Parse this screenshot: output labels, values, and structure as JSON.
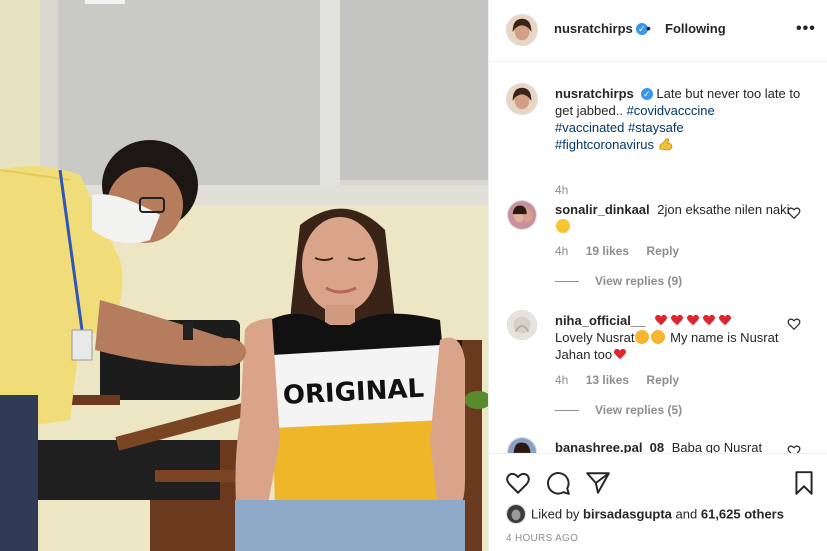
{
  "post": {
    "username": "nusratchirps",
    "verified_mark": "✓",
    "separator": "•",
    "follow_status": "Following",
    "more_label": "•••"
  },
  "caption": {
    "username": "nusratchirps",
    "text": "Late but never too late to get jabbed..",
    "hashtags": [
      "#covidvacccine",
      "#vaccinated",
      "#staysafe",
      "#fightcoronavirus"
    ],
    "time": "4h"
  },
  "comments": [
    {
      "username": "sonalir_dinkaal",
      "text": "2jon eksathe nilen naki",
      "emoji": "joy-emoji",
      "time": "4h",
      "likes": "19 likes",
      "reply_label": "Reply",
      "view_replies": "View replies (9)"
    },
    {
      "username": "niha_official__",
      "text_part1": "Lovely Nusrat",
      "text_part2": "My name is Nusrat Jahan too",
      "emojis": [
        "red-heart-emoji",
        "red-heart-emoji",
        "red-heart-emoji",
        "red-heart-emoji",
        "red-heart-emoji"
      ],
      "time": "4h",
      "likes": "13 likes",
      "reply_label": "Reply",
      "view_replies": "View replies (5)"
    },
    {
      "username": "banashree.pal_08",
      "text": "Baba go Nusrat"
    }
  ],
  "actions": {
    "icons": [
      "heart-icon",
      "comment-icon",
      "share-icon",
      "bookmark-icon"
    ]
  },
  "likes": {
    "prefix": "Liked by",
    "liker": "birsadasgupta",
    "connector": "and",
    "others": "61,625 others"
  },
  "timestamp": "4 HOURS AGO",
  "photo": {
    "shirt_text": "ORIGINAL"
  },
  "colors": {
    "link": "#00376b",
    "verified": "#3897f0",
    "secondary": "#8e8e8e",
    "heart": "#ed4956"
  }
}
